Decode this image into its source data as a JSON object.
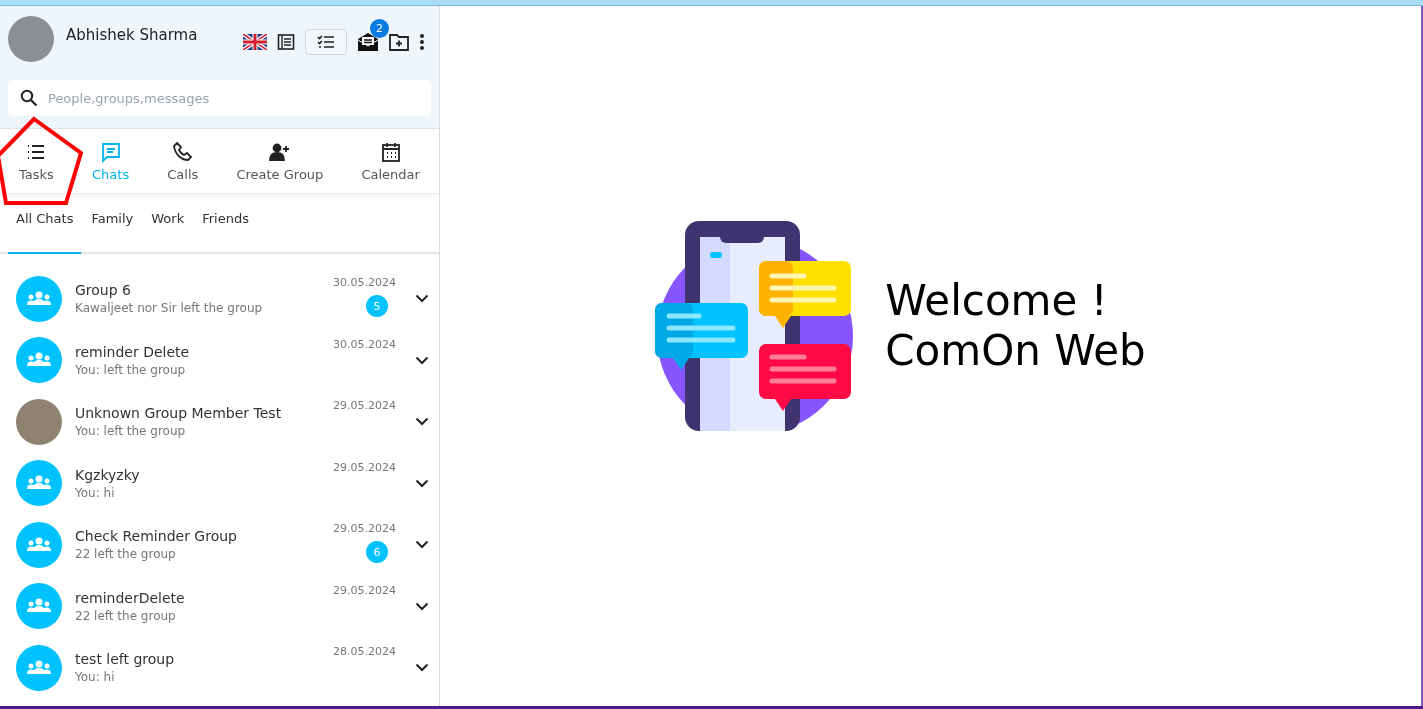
{
  "profile": {
    "name": "Abhishek  Sharma",
    "notification_count": "2"
  },
  "search": {
    "placeholder": "People,groups,messages"
  },
  "nav_tabs": [
    {
      "label": "Tasks",
      "selected": false
    },
    {
      "label": "Chats",
      "selected": true
    },
    {
      "label": "Calls",
      "selected": false
    },
    {
      "label": "Create Group",
      "selected": false
    },
    {
      "label": "Calendar",
      "selected": false
    }
  ],
  "filter_tabs": [
    {
      "label": "All Chats",
      "selected": true
    },
    {
      "label": "Family",
      "selected": false
    },
    {
      "label": "Work",
      "selected": false
    },
    {
      "label": "Friends",
      "selected": false
    }
  ],
  "chats": [
    {
      "kind": "group",
      "name": "Group 6",
      "preview": "Kawaljeet nor Sir left the group",
      "date": "30.05.2024",
      "unread": "5"
    },
    {
      "kind": "group",
      "name": "reminder Delete",
      "preview": "You:  left the group",
      "date": "30.05.2024"
    },
    {
      "kind": "photo",
      "name": "Unknown Group Member Test",
      "preview": "You:  left the group",
      "date": "29.05.2024"
    },
    {
      "kind": "group",
      "name": "Kgzkyzky",
      "preview": "You: hi",
      "date": "29.05.2024"
    },
    {
      "kind": "group",
      "name": "Check Reminder Group",
      "preview": "22 left the group",
      "date": "29.05.2024",
      "unread": "6"
    },
    {
      "kind": "group",
      "name": "reminderDelete",
      "preview": "22 left the group",
      "date": "29.05.2024"
    },
    {
      "kind": "group",
      "name": "test left group",
      "preview": "You: hi",
      "date": "28.05.2024"
    }
  ],
  "welcome": {
    "line_1": "Welcome !",
    "line_2": "ComOn Web"
  }
}
